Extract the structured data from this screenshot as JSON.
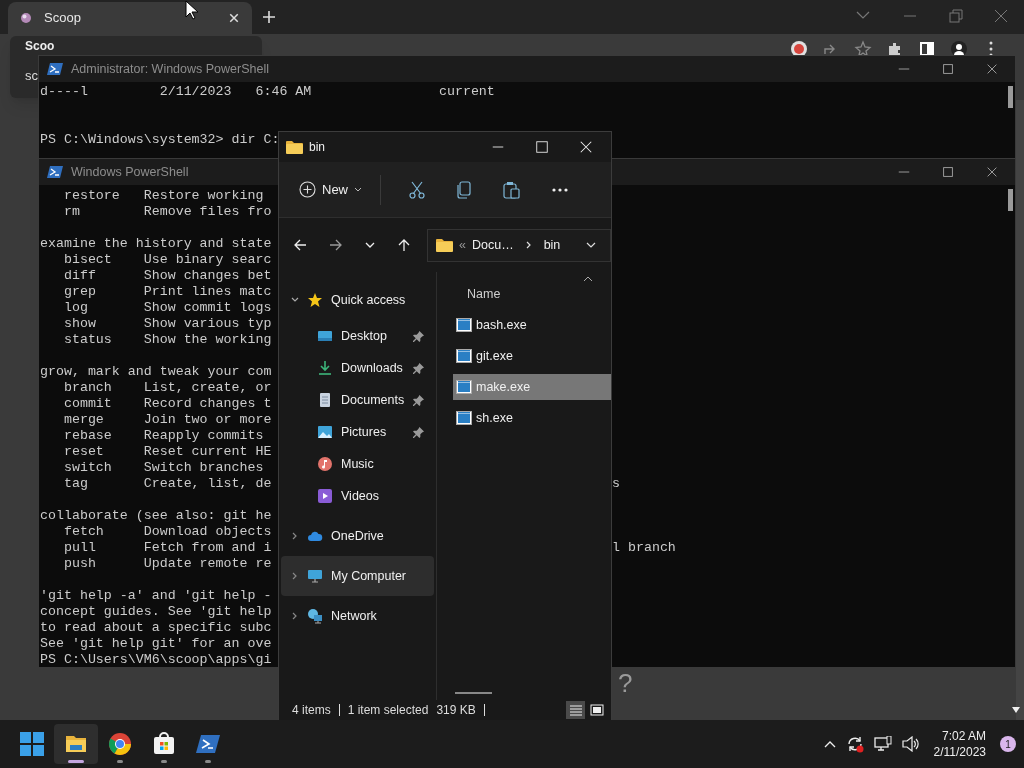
{
  "browser": {
    "tabs": [
      {
        "title": "Scoop",
        "selected": true
      }
    ],
    "tooltip": {
      "title": "Scoo",
      "subtitle": "sc"
    },
    "page_text": "?"
  },
  "admin_powershell": {
    "title": "Administrator: Windows PowerShell",
    "lines": [
      {
        "text": "d----l         2/11/2023   6:46 AM                current"
      },
      {
        "text": "PS C:\\Windows\\system32> dir C:",
        "gap_before": true
      }
    ]
  },
  "powershell": {
    "title": "Windows PowerShell",
    "lines": [
      {
        "text": "   restore   Restore working"
      },
      {
        "text": "   rm        Remove files fro"
      },
      {
        "text": "examine the history and state",
        "gap_before": true
      },
      {
        "text": "   bisect    Use binary searc"
      },
      {
        "text": "   diff      Show changes bet"
      },
      {
        "text": "   grep      Print lines matc"
      },
      {
        "text": "   log       Show commit logs"
      },
      {
        "text": "   show      Show various typ"
      },
      {
        "text": "   status    Show the working"
      },
      {
        "text": "grow, mark and tweak your com",
        "gap_before": true
      },
      {
        "text": "   branch    List, create, or"
      },
      {
        "text": "   commit    Record changes t"
      },
      {
        "text": "   merge     Join two or more"
      },
      {
        "text": "   rebase    Reapply commits"
      },
      {
        "text": "   reset     Reset current HE"
      },
      {
        "text": "   switch    Switch branches"
      },
      {
        "text": "   tag       Create, list, de",
        "tail": "s"
      },
      {
        "text": "collaborate (see also: git he",
        "gap_before": true
      },
      {
        "text": "   fetch     Download objects"
      },
      {
        "text": "   pull      Fetch from and i",
        "tail": "l branch"
      },
      {
        "text": "   push      Update remote re"
      },
      {
        "text": "'git help -a' and 'git help -",
        "gap_before": true
      },
      {
        "text": "concept guides. See 'git help"
      },
      {
        "text": "to read about a specific subc"
      },
      {
        "text": "See 'git help git' for an ove"
      },
      {
        "text": "PS C:\\Users\\VM6\\scoop\\apps\\gi"
      }
    ]
  },
  "explorer": {
    "title": "bin",
    "new_label": "New",
    "breadcrumb": {
      "overflow": "«",
      "items": [
        "Docu…",
        "bin"
      ]
    },
    "nav": [
      {
        "label": "Quick access",
        "kind": "star",
        "expanded": true,
        "selected": false,
        "children": [
          {
            "label": "Desktop",
            "kind": "desktop",
            "pinned": true,
            "selected": false
          },
          {
            "label": "Downloads",
            "kind": "download",
            "pinned": true,
            "selected": false
          },
          {
            "label": "Documents",
            "kind": "document",
            "pinned": true,
            "selected": false
          },
          {
            "label": "Pictures",
            "kind": "pictures",
            "pinned": true,
            "selected": false
          },
          {
            "label": "Music",
            "kind": "music",
            "pinned": false,
            "selected": false
          },
          {
            "label": "Videos",
            "kind": "videos",
            "pinned": false,
            "selected": false
          }
        ]
      },
      {
        "label": "OneDrive",
        "kind": "cloud",
        "expanded": false,
        "selected": false
      },
      {
        "label": "My Computer",
        "kind": "computer",
        "expanded": false,
        "selected": true
      },
      {
        "label": "Network",
        "kind": "network",
        "expanded": false,
        "selected": false
      }
    ],
    "column": "Name",
    "files": [
      {
        "name": "bash.exe",
        "selected": false
      },
      {
        "name": "git.exe",
        "selected": false
      },
      {
        "name": "make.exe",
        "selected": true
      },
      {
        "name": "sh.exe",
        "selected": false
      }
    ],
    "status": {
      "count": "4 items",
      "selection": "1 item selected",
      "size": "319 KB"
    },
    "views": [
      {
        "kind": "details",
        "selected": true
      },
      {
        "kind": "tiles",
        "selected": false
      }
    ]
  },
  "taskbar": {
    "apps": [
      {
        "kind": "explorer",
        "active": true
      },
      {
        "kind": "browser",
        "active": false
      },
      {
        "kind": "store",
        "active": false
      },
      {
        "kind": "terminal",
        "active": false
      }
    ],
    "time": "7:02 AM",
    "date": "2/11/2023",
    "badge": "1"
  }
}
